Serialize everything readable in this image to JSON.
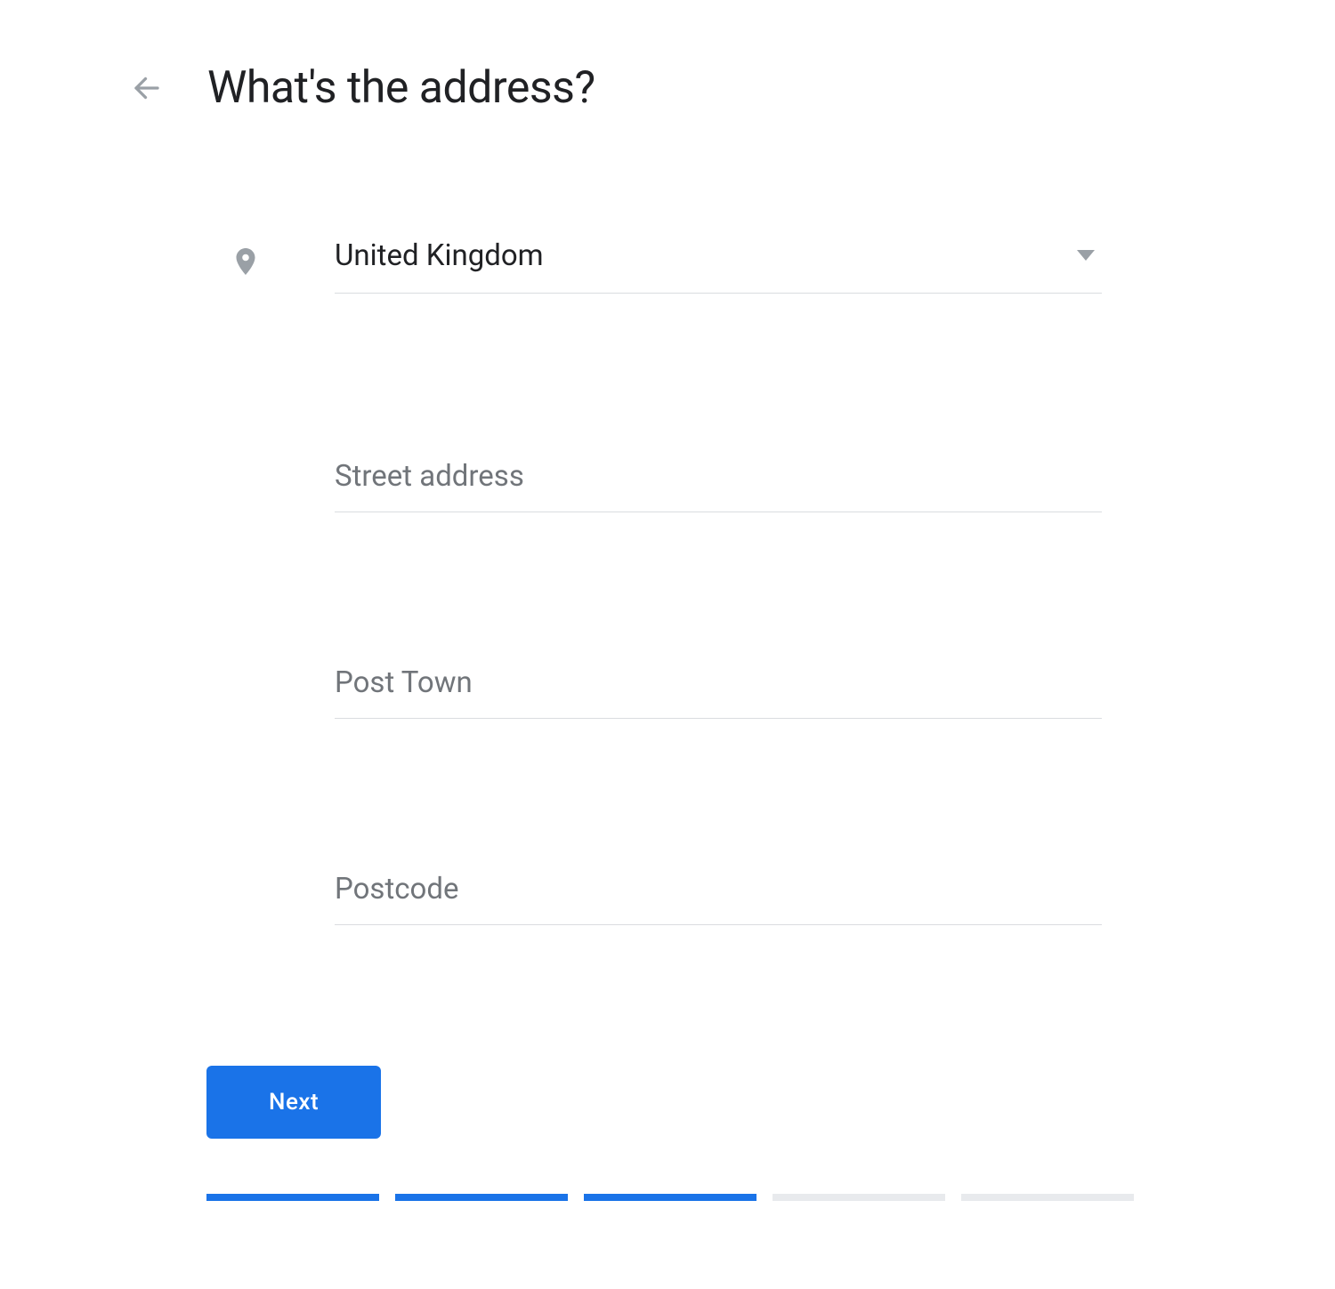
{
  "header": {
    "title": "What's the address?"
  },
  "form": {
    "country": {
      "selected": "United Kingdom"
    },
    "street": {
      "placeholder": "Street address",
      "value": ""
    },
    "post_town": {
      "placeholder": "Post Town",
      "value": ""
    },
    "postcode": {
      "placeholder": "Postcode",
      "value": ""
    }
  },
  "actions": {
    "next_label": "Next"
  },
  "progress": {
    "total": 5,
    "completed": 3
  },
  "colors": {
    "primary": "#1a73e8",
    "text": "#202124",
    "placeholder": "#71757a",
    "divider": "#dadce0",
    "progress_todo": "#e8eaed"
  }
}
